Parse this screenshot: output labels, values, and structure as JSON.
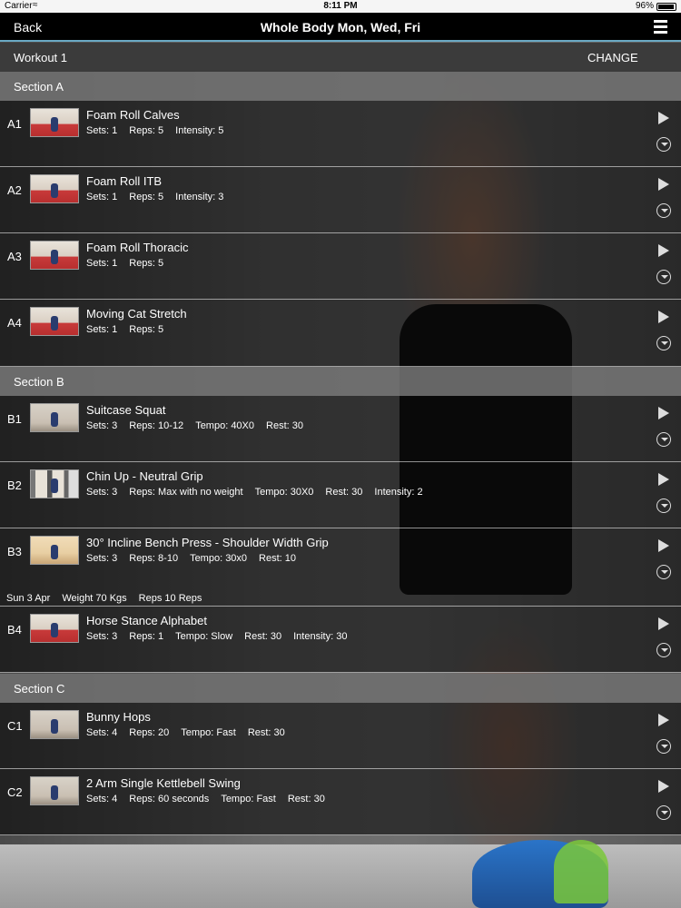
{
  "status_bar": {
    "carrier": "Carrier",
    "time": "8:11 PM",
    "battery": "96%"
  },
  "nav": {
    "back_label": "Back",
    "title": "Whole Body Mon, Wed, Fri"
  },
  "workout": {
    "label": "Workout 1",
    "change_label": "CHANGE"
  },
  "sections": [
    {
      "title": "Section A",
      "exercises": [
        {
          "code": "A1",
          "name": "Foam Roll Calves",
          "details": [
            "Sets: 1",
            "Reps: 5",
            "Intensity: 5"
          ]
        },
        {
          "code": "A2",
          "name": "Foam Roll ITB",
          "details": [
            "Sets: 1",
            "Reps: 5",
            "Intensity: 3"
          ]
        },
        {
          "code": "A3",
          "name": "Foam Roll Thoracic",
          "details": [
            "Sets: 1",
            "Reps: 5"
          ]
        },
        {
          "code": "A4",
          "name": "Moving Cat Stretch",
          "details": [
            "Sets: 1",
            "Reps: 5"
          ]
        }
      ]
    },
    {
      "title": "Section B",
      "exercises": [
        {
          "code": "B1",
          "name": "Suitcase Squat",
          "details": [
            "Sets: 3",
            "Reps: 10-12",
            "Tempo: 40X0",
            "Rest: 30"
          ]
        },
        {
          "code": "B2",
          "name": "Chin Up - Neutral Grip",
          "details": [
            "Sets: 3",
            "Reps: Max with no weight",
            "Tempo: 30X0",
            "Rest: 30",
            "Intensity: 2"
          ]
        },
        {
          "code": "B3",
          "name": "30° Incline Bench Press - Shoulder Width Grip",
          "details": [
            "Sets: 3",
            "Reps: 8-10",
            "Tempo: 30x0",
            "Rest: 10"
          ],
          "history": [
            "Sun 3 Apr",
            "Weight 70 Kgs",
            "Reps 10 Reps"
          ]
        },
        {
          "code": "B4",
          "name": "Horse Stance Alphabet",
          "details": [
            "Sets: 3",
            "Reps: 1",
            "Tempo: Slow",
            "Rest: 30",
            "Intensity: 30"
          ]
        }
      ]
    },
    {
      "title": "Section C",
      "exercises": [
        {
          "code": "C1",
          "name": "Bunny Hops",
          "details": [
            "Sets: 4",
            "Reps: 20",
            "Tempo: Fast",
            "Rest: 30"
          ]
        },
        {
          "code": "C2",
          "name": "2 Arm Single Kettlebell Swing",
          "details": [
            "Sets: 4",
            "Reps: 60 seconds",
            "Tempo: Fast",
            "Rest: 30"
          ]
        }
      ]
    }
  ],
  "colors": {
    "nav_accent": "#6aa9c4",
    "section_header": "#6e6e6e"
  }
}
